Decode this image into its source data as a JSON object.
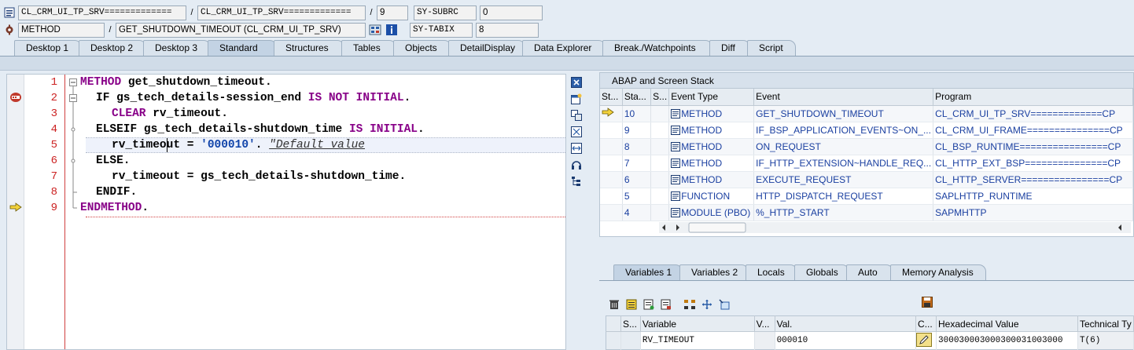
{
  "header": {
    "row1": {
      "include": "CL_CRM_UI_TP_SRV=============",
      "program": "CL_CRM_UI_TP_SRV=============",
      "line": "9",
      "sysfield": "SY-SUBRC",
      "sysvalue": "0"
    },
    "row2": {
      "kind": "METHOD",
      "event": "GET_SHUTDOWN_TIMEOUT (CL_CRM_UI_TP_SRV)",
      "sysfield": "SY-TABIX",
      "sysvalue": "8"
    },
    "sep": "/"
  },
  "tabs": [
    "Desktop 1",
    "Desktop 2",
    "Desktop 3",
    "Standard",
    "Structures",
    "Tables",
    "Objects",
    "DetailDisplay",
    "Data Explorer",
    "Break./Watchpoints",
    "Diff",
    "Script"
  ],
  "active_tab": "Standard",
  "code": {
    "lines": [
      {
        "n": "1"
      },
      {
        "n": "2"
      },
      {
        "n": "3"
      },
      {
        "n": "4"
      },
      {
        "n": "5"
      },
      {
        "n": "6"
      },
      {
        "n": "7"
      },
      {
        "n": "8"
      },
      {
        "n": "9"
      }
    ],
    "tokens": {
      "l1_kw": "METHOD",
      "l1_rest": " get_shutdown_timeout.",
      "l2_kw": "IF",
      "l2_mid": " gs_tech_details-session_end ",
      "l2_kw2": "IS NOT INITIAL",
      "l2_end": ".",
      "l3_kw": "CLEAR",
      "l3_rest": " rv_timeout.",
      "l4_kw": "ELSEIF",
      "l4_mid": " gs_tech_details-shutdown_time ",
      "l4_kw2": "IS INITIAL",
      "l4_end": ".",
      "l5_a": "rv_timeout = ",
      "l5_str": "'000010'",
      "l5_dot": ". ",
      "l5_cmt": "\"Default value",
      "l6": "ELSE.",
      "l7": "rv_timeout = gs_tech_details-shutdown_time.",
      "l8": "ENDIF.",
      "l9_kw": "ENDMETHOD",
      "l9_end": "."
    }
  },
  "stack": {
    "title": "ABAP and Screen Stack",
    "columns": [
      "St...",
      "Sta...",
      "S...",
      "Event Type",
      "Event",
      "Program"
    ],
    "rows": [
      {
        "sta": "10",
        "type": "METHOD",
        "event": "GET_SHUTDOWN_TIMEOUT",
        "program": "CL_CRM_UI_TP_SRV=============CP"
      },
      {
        "sta": "9",
        "type": "METHOD",
        "event": "IF_BSP_APPLICATION_EVENTS~ON_...",
        "program": "CL_CRM_UI_FRAME===============CP"
      },
      {
        "sta": "8",
        "type": "METHOD",
        "event": "ON_REQUEST",
        "program": "CL_BSP_RUNTIME================CP"
      },
      {
        "sta": "7",
        "type": "METHOD",
        "event": "IF_HTTP_EXTENSION~HANDLE_REQ...",
        "program": "CL_HTTP_EXT_BSP===============CP"
      },
      {
        "sta": "6",
        "type": "METHOD",
        "event": "EXECUTE_REQUEST",
        "program": "CL_HTTP_SERVER================CP"
      },
      {
        "sta": "5",
        "type": "FUNCTION",
        "event": "HTTP_DISPATCH_REQUEST",
        "program": "SAPLHTTP_RUNTIME"
      },
      {
        "sta": "4",
        "type": "MODULE (PBO)",
        "event": "%_HTTP_START",
        "program": "SAPMHTTP"
      }
    ]
  },
  "var_tabs": [
    "Variables 1",
    "Variables 2",
    "Locals",
    "Globals",
    "Auto",
    "Memory Analysis"
  ],
  "var_active": "Variables 1",
  "variables": {
    "columns": [
      "S...",
      "Variable",
      "V...",
      "Val.",
      "C...",
      "Hexadecimal Value",
      "Technical Ty"
    ],
    "rows": [
      {
        "name": "RV_TIMEOUT",
        "value": "000010",
        "hex": "300030003000300031003000",
        "techtype": "T(6)"
      }
    ]
  },
  "colors": {
    "keyword": "#880088",
    "string": "#1144aa",
    "line_number": "#cc2222",
    "link": "#1a3fa0"
  }
}
